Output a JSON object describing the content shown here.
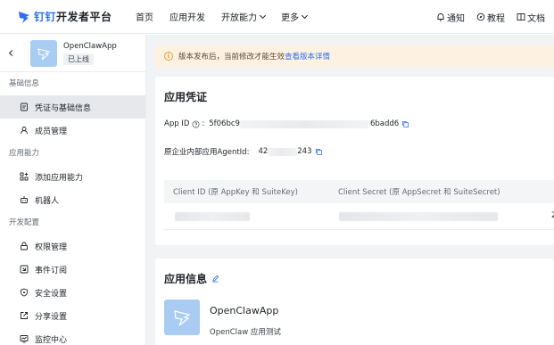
{
  "brand": {
    "logo_mark": "钉钉",
    "title": "开发者平台"
  },
  "nav": [
    {
      "label": "首页"
    },
    {
      "label": "应用开发"
    },
    {
      "label": "开放能力"
    },
    {
      "label": "更多"
    }
  ],
  "top_links": [
    {
      "label": "通知",
      "icon": "bell-icon"
    },
    {
      "label": "教程",
      "icon": "compass-icon"
    },
    {
      "label": "文档",
      "icon": "book-icon"
    }
  ],
  "app": {
    "name": "OpenClawApp",
    "status": "已上线"
  },
  "sidebar": {
    "sections": [
      {
        "title": "基础信息",
        "items": [
          {
            "label": "凭证与基础信息",
            "icon": "credential-icon",
            "active": true
          },
          {
            "label": "成员管理",
            "icon": "person-icon"
          }
        ]
      },
      {
        "title": "应用能力",
        "items": [
          {
            "label": "添加应用能力",
            "icon": "grid-plus-icon"
          },
          {
            "label": "机器人",
            "icon": "robot-icon"
          }
        ]
      },
      {
        "title": "开发配置",
        "items": [
          {
            "label": "权限管理",
            "icon": "lock-icon"
          },
          {
            "label": "事件订阅",
            "icon": "event-icon"
          },
          {
            "label": "安全设置",
            "icon": "shield-icon"
          },
          {
            "label": "分享设置",
            "icon": "share-icon"
          },
          {
            "label": "监控中心",
            "icon": "monitor-icon"
          }
        ]
      }
    ]
  },
  "notice": {
    "text": "版本发布后，当前修改才能生效",
    "link": "查看版本详情"
  },
  "credentials": {
    "title": "应用凭证",
    "app_id_label": "App ID",
    "app_id_prefix": "5f06bc9",
    "app_id_suffix": "6badd6",
    "agent_label": "原企业内部应用AgentId:",
    "agent_prefix": "42",
    "agent_suffix": "243",
    "columns": [
      "Client ID (原 AppKey 和 SuiteKey)",
      "Client Secret (原 AppSecret 和 SuiteSecret)"
    ],
    "row_tail": "2"
  },
  "app_info": {
    "title": "应用信息",
    "name": "OpenClawApp",
    "description": "OpenClaw 应用测试"
  },
  "colors": {
    "accent": "#2c6ef2",
    "notice_bg": "#fdf1e2",
    "warn": "#f29b38",
    "thumb": "#a9cdf2"
  }
}
